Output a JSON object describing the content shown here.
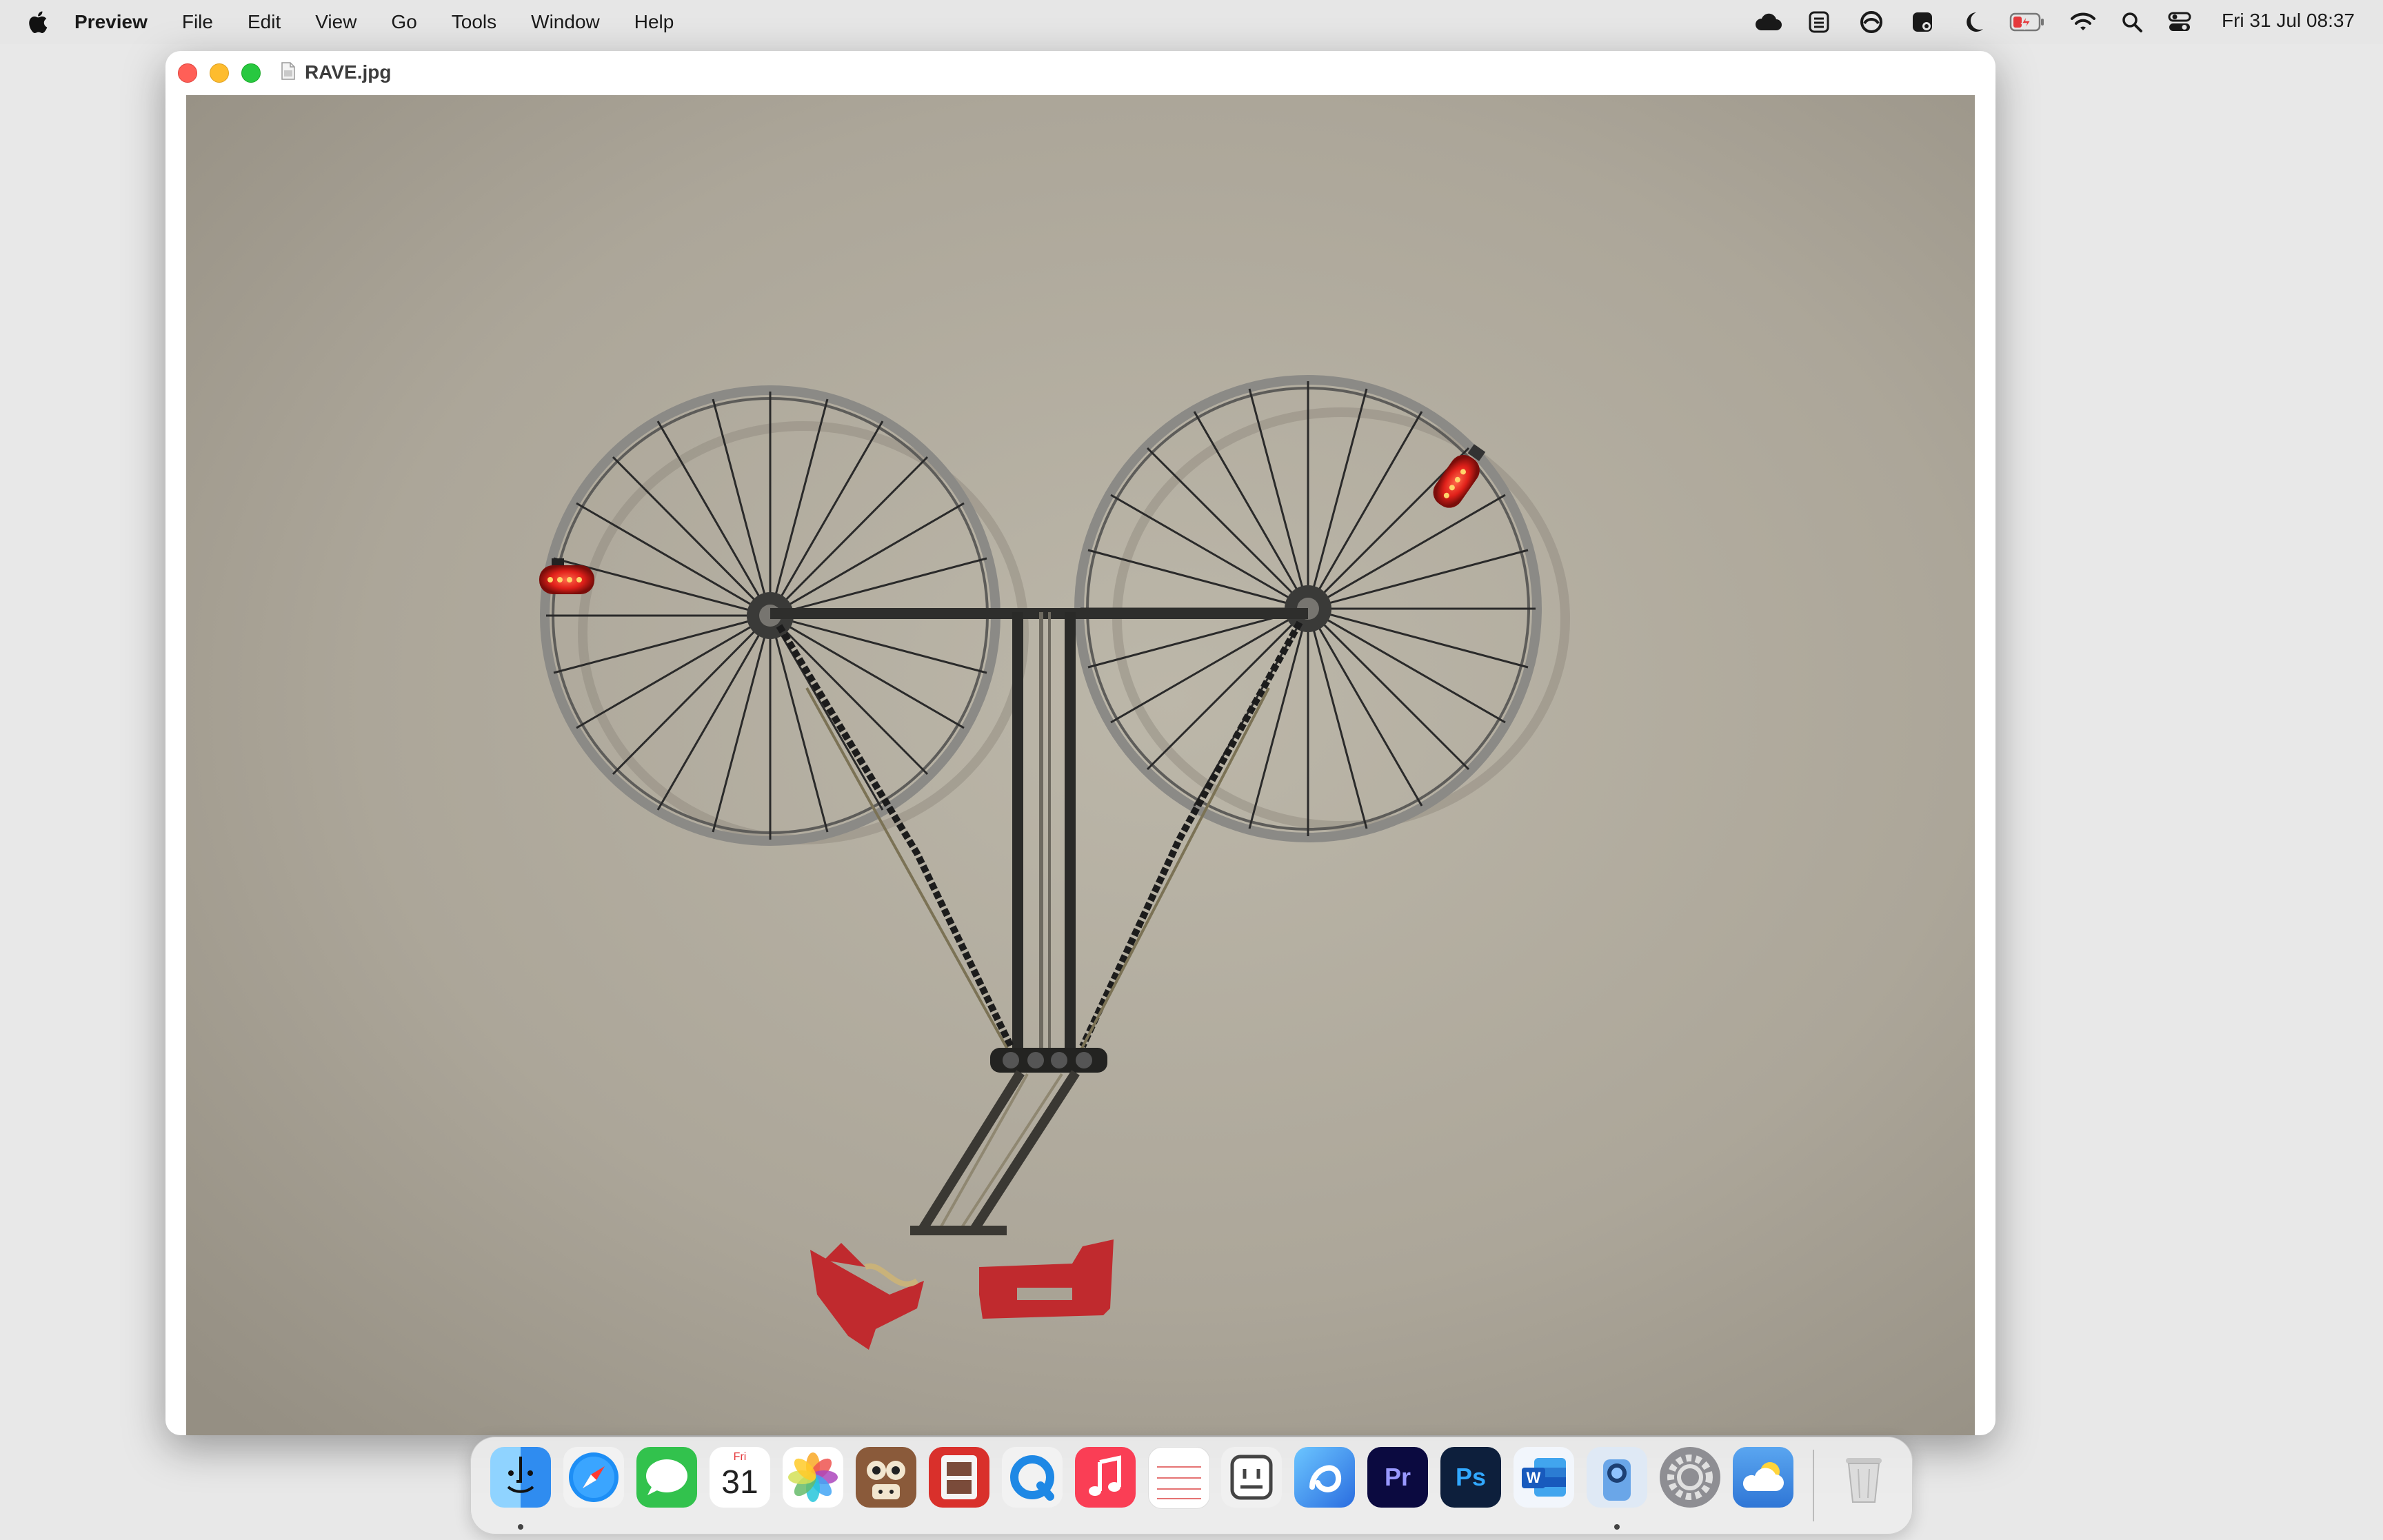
{
  "menubar": {
    "apple_icon": "apple-logo-icon",
    "app_name": "Preview",
    "items": [
      "File",
      "Edit",
      "View",
      "Go",
      "Tools",
      "Window",
      "Help"
    ],
    "status_icons": [
      "creative-cloud-icon",
      "vpn-shield-icon",
      "sync-icon",
      "settings-widget-icon",
      "focus-moon-icon",
      "battery-charging-icon",
      "wifi-icon",
      "spotlight-search-icon",
      "control-center-icon"
    ],
    "clock": "Fri 31 Jul  08:37"
  },
  "window": {
    "title": "RAVE.jpg",
    "image_description_icon": "document-icon"
  },
  "dock": {
    "apps": [
      {
        "name": "Finder",
        "icon": "finder-icon",
        "color": "#2f8cf0",
        "running": true
      },
      {
        "name": "Safari",
        "icon": "safari-compass-icon",
        "color": "#1d8ef5",
        "running": false
      },
      {
        "name": "Messages",
        "icon": "messages-bubble-icon",
        "color": "#32c24d",
        "running": false
      },
      {
        "name": "Calendar",
        "icon": "calendar-icon",
        "color": "#ffffff",
        "running": false,
        "day_label": "Fri",
        "date_label": "31"
      },
      {
        "name": "Photos",
        "icon": "photos-flower-icon",
        "color": "#ffffff",
        "running": false
      },
      {
        "name": "Mini Metro",
        "icon": "game-owl-icon",
        "color": "#8a5a3a",
        "running": false
      },
      {
        "name": "Photo Booth",
        "icon": "photo-booth-icon",
        "color": "#d9302b",
        "running": false
      },
      {
        "name": "QuickTime Player",
        "icon": "quicktime-icon",
        "color": "#1e88e5",
        "running": false
      },
      {
        "name": "Music",
        "icon": "music-note-icon",
        "color": "#fa3e55",
        "running": false
      },
      {
        "name": "Reminders",
        "icon": "reminders-list-icon",
        "color": "#ffffff",
        "running": false
      },
      {
        "name": "Mastodon",
        "icon": "robot-face-icon",
        "color": "#f0f0f0",
        "running": false
      },
      {
        "name": "Copilot",
        "icon": "copilot-icon",
        "color": "#2a6de0",
        "running": false
      },
      {
        "name": "Premiere Pro",
        "icon": "premiere-pro-icon",
        "color": "#0b0a40",
        "running": false,
        "label": "Pr"
      },
      {
        "name": "Photoshop",
        "icon": "photoshop-icon",
        "color": "#0d1f3c",
        "running": false,
        "label": "Ps"
      },
      {
        "name": "Word",
        "icon": "word-icon",
        "color": "#ffffff",
        "running": false,
        "label": "W"
      },
      {
        "name": "Preview",
        "icon": "preview-icon",
        "color": "#6aa6e8",
        "running": true
      },
      {
        "name": "System Settings",
        "icon": "gear-icon",
        "color": "#8e8e93",
        "running": false
      },
      {
        "name": "Weather",
        "icon": "weather-cloud-icon",
        "color": "#3a8ee6",
        "running": false
      }
    ],
    "trash_icon": "trash-icon"
  }
}
